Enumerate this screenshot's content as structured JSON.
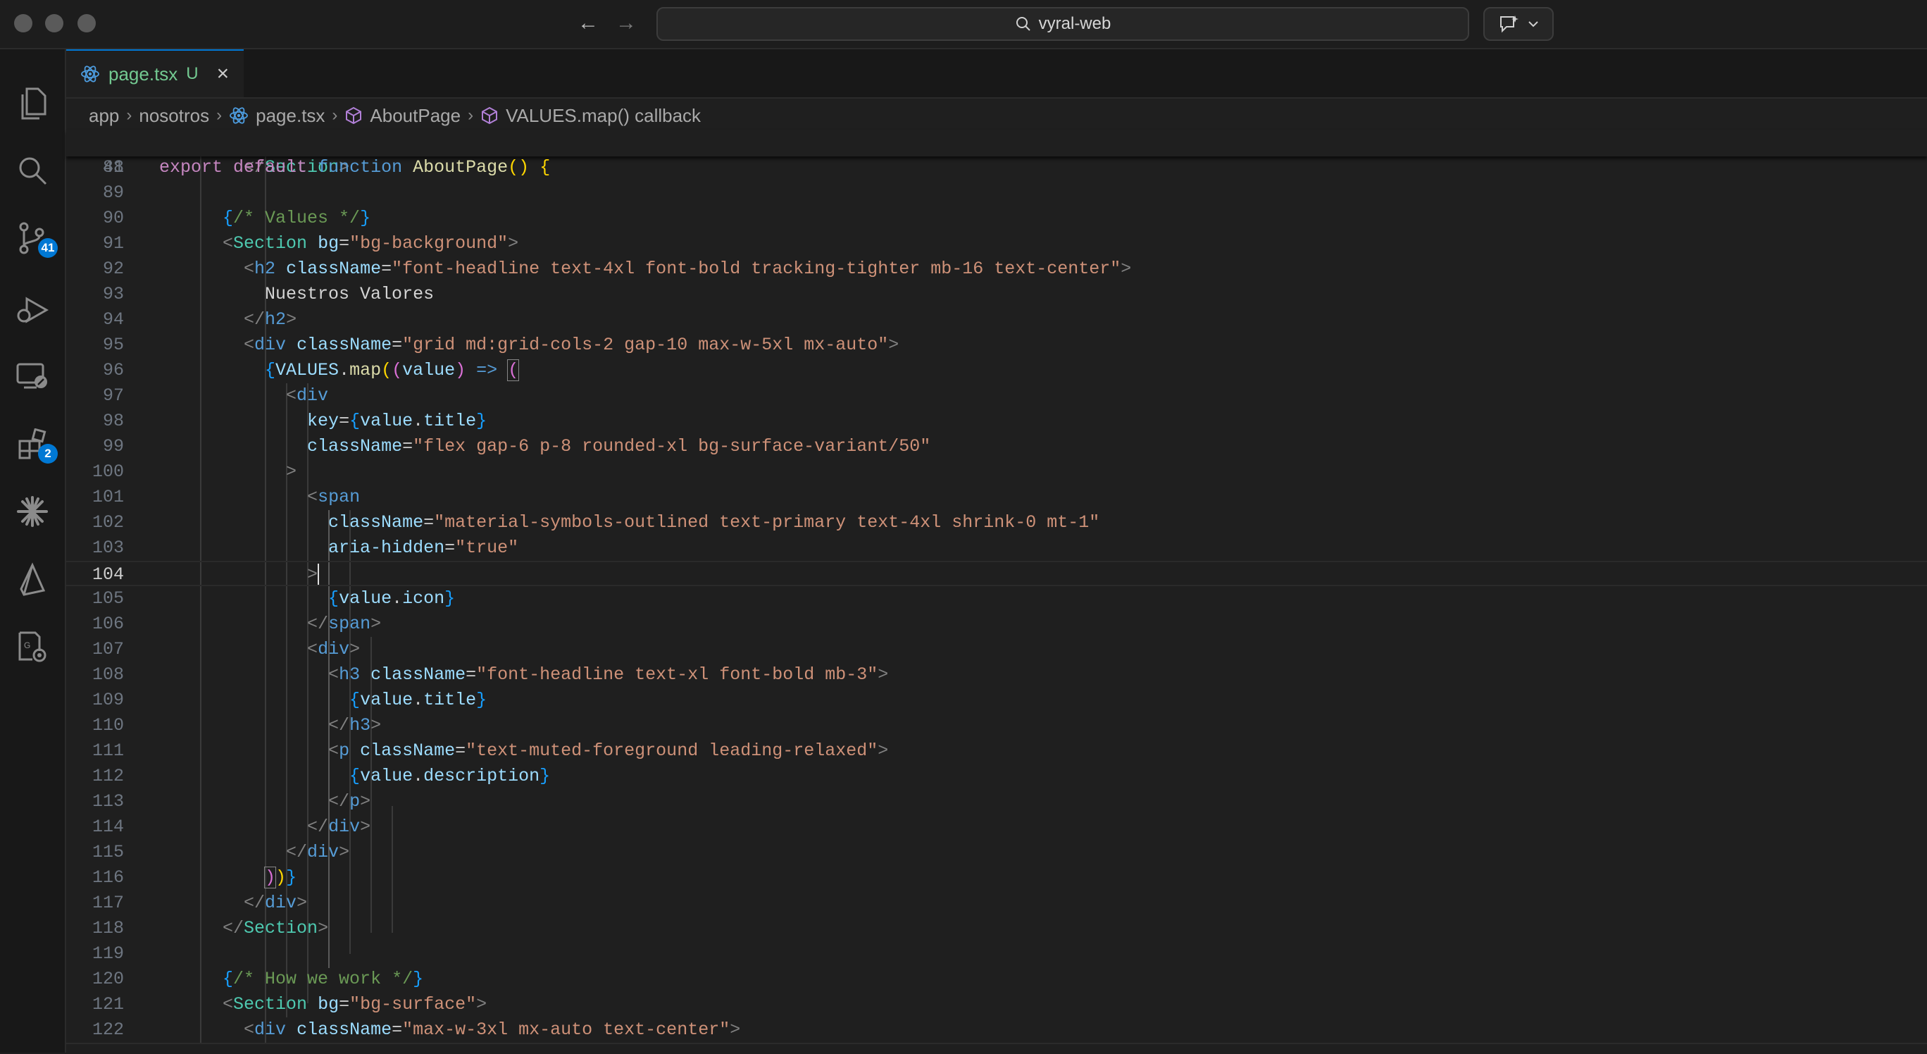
{
  "window": {
    "search_text": "vyral-web",
    "traffic_lights": [
      "close",
      "minimize",
      "zoom"
    ]
  },
  "activity_bar": {
    "source_control_badge": "41",
    "extensions_badge": "2"
  },
  "tabs": [
    {
      "label": "page.tsx",
      "status": "U",
      "close_glyph": "×"
    }
  ],
  "breadcrumb": {
    "items": [
      "app",
      "nosotros",
      "page.tsx",
      "AboutPage",
      "VALUES.map() callback"
    ]
  },
  "editor": {
    "sticky_line_number": "41",
    "current_line": "104",
    "line_numbers": [
      "88",
      "89",
      "90",
      "91",
      "92",
      "93",
      "94",
      "95",
      "96",
      "97",
      "98",
      "99",
      "100",
      "101",
      "102",
      "103",
      "104",
      "105",
      "106",
      "107",
      "108",
      "109",
      "110",
      "111",
      "112",
      "113",
      "114",
      "115",
      "116",
      "117",
      "118",
      "119",
      "120",
      "121",
      "122"
    ],
    "strings": {
      "s92": "\"font-headline text-4xl font-bold tracking-tighter mb-16 text-center\"",
      "s93": "Nuestros Valores",
      "s95": "\"grid md:grid-cols-2 gap-10 max-w-5xl mx-auto\"",
      "s99": "\"flex gap-6 p-8 rounded-xl bg-surface-variant/50\"",
      "s102": "\"material-symbols-outlined text-primary text-4xl shrink-0 mt-1\"",
      "s103": "\"true\"",
      "s108": "\"font-headline text-xl font-bold mb-3\"",
      "s111": "\"text-muted-foreground leading-relaxed\"",
      "s121": "\"bg-surface\"",
      "s122": "\"max-w-3xl mx-auto text-center\"",
      "s91": "\"bg-background\"",
      "c90": "/* Values */",
      "c120": "/* How we work */"
    }
  }
}
